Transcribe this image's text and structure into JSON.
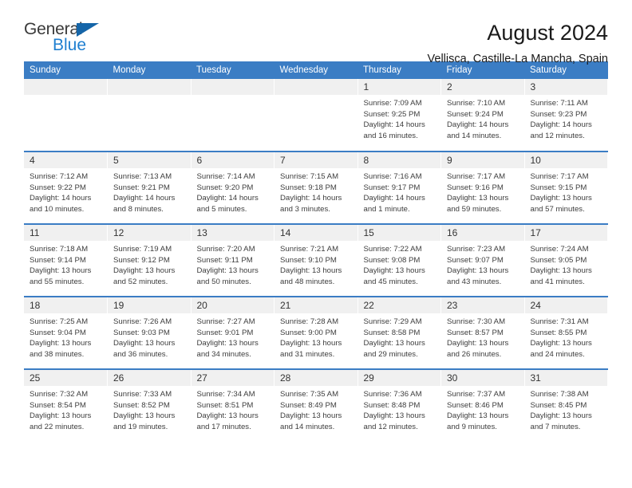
{
  "brand": {
    "name_top": "General",
    "name_bottom": "Blue",
    "accent_color": "#1f7fd0",
    "triangle_color": "#1565a8"
  },
  "header": {
    "title": "August 2024",
    "subtitle": "Vellisca, Castille-La Mancha, Spain"
  },
  "calendar": {
    "header_bg": "#3b7dc4",
    "daynum_bg": "#f0f0f0",
    "weekday_headers": [
      "Sunday",
      "Monday",
      "Tuesday",
      "Wednesday",
      "Thursday",
      "Friday",
      "Saturday"
    ],
    "weeks": [
      [
        {
          "day": "",
          "lines": []
        },
        {
          "day": "",
          "lines": []
        },
        {
          "day": "",
          "lines": []
        },
        {
          "day": "",
          "lines": []
        },
        {
          "day": "1",
          "lines": [
            "Sunrise: 7:09 AM",
            "Sunset: 9:25 PM",
            "Daylight: 14 hours",
            "and 16 minutes."
          ]
        },
        {
          "day": "2",
          "lines": [
            "Sunrise: 7:10 AM",
            "Sunset: 9:24 PM",
            "Daylight: 14 hours",
            "and 14 minutes."
          ]
        },
        {
          "day": "3",
          "lines": [
            "Sunrise: 7:11 AM",
            "Sunset: 9:23 PM",
            "Daylight: 14 hours",
            "and 12 minutes."
          ]
        }
      ],
      [
        {
          "day": "4",
          "lines": [
            "Sunrise: 7:12 AM",
            "Sunset: 9:22 PM",
            "Daylight: 14 hours",
            "and 10 minutes."
          ]
        },
        {
          "day": "5",
          "lines": [
            "Sunrise: 7:13 AM",
            "Sunset: 9:21 PM",
            "Daylight: 14 hours",
            "and 8 minutes."
          ]
        },
        {
          "day": "6",
          "lines": [
            "Sunrise: 7:14 AM",
            "Sunset: 9:20 PM",
            "Daylight: 14 hours",
            "and 5 minutes."
          ]
        },
        {
          "day": "7",
          "lines": [
            "Sunrise: 7:15 AM",
            "Sunset: 9:18 PM",
            "Daylight: 14 hours",
            "and 3 minutes."
          ]
        },
        {
          "day": "8",
          "lines": [
            "Sunrise: 7:16 AM",
            "Sunset: 9:17 PM",
            "Daylight: 14 hours",
            "and 1 minute."
          ]
        },
        {
          "day": "9",
          "lines": [
            "Sunrise: 7:17 AM",
            "Sunset: 9:16 PM",
            "Daylight: 13 hours",
            "and 59 minutes."
          ]
        },
        {
          "day": "10",
          "lines": [
            "Sunrise: 7:17 AM",
            "Sunset: 9:15 PM",
            "Daylight: 13 hours",
            "and 57 minutes."
          ]
        }
      ],
      [
        {
          "day": "11",
          "lines": [
            "Sunrise: 7:18 AM",
            "Sunset: 9:14 PM",
            "Daylight: 13 hours",
            "and 55 minutes."
          ]
        },
        {
          "day": "12",
          "lines": [
            "Sunrise: 7:19 AM",
            "Sunset: 9:12 PM",
            "Daylight: 13 hours",
            "and 52 minutes."
          ]
        },
        {
          "day": "13",
          "lines": [
            "Sunrise: 7:20 AM",
            "Sunset: 9:11 PM",
            "Daylight: 13 hours",
            "and 50 minutes."
          ]
        },
        {
          "day": "14",
          "lines": [
            "Sunrise: 7:21 AM",
            "Sunset: 9:10 PM",
            "Daylight: 13 hours",
            "and 48 minutes."
          ]
        },
        {
          "day": "15",
          "lines": [
            "Sunrise: 7:22 AM",
            "Sunset: 9:08 PM",
            "Daylight: 13 hours",
            "and 45 minutes."
          ]
        },
        {
          "day": "16",
          "lines": [
            "Sunrise: 7:23 AM",
            "Sunset: 9:07 PM",
            "Daylight: 13 hours",
            "and 43 minutes."
          ]
        },
        {
          "day": "17",
          "lines": [
            "Sunrise: 7:24 AM",
            "Sunset: 9:05 PM",
            "Daylight: 13 hours",
            "and 41 minutes."
          ]
        }
      ],
      [
        {
          "day": "18",
          "lines": [
            "Sunrise: 7:25 AM",
            "Sunset: 9:04 PM",
            "Daylight: 13 hours",
            "and 38 minutes."
          ]
        },
        {
          "day": "19",
          "lines": [
            "Sunrise: 7:26 AM",
            "Sunset: 9:03 PM",
            "Daylight: 13 hours",
            "and 36 minutes."
          ]
        },
        {
          "day": "20",
          "lines": [
            "Sunrise: 7:27 AM",
            "Sunset: 9:01 PM",
            "Daylight: 13 hours",
            "and 34 minutes."
          ]
        },
        {
          "day": "21",
          "lines": [
            "Sunrise: 7:28 AM",
            "Sunset: 9:00 PM",
            "Daylight: 13 hours",
            "and 31 minutes."
          ]
        },
        {
          "day": "22",
          "lines": [
            "Sunrise: 7:29 AM",
            "Sunset: 8:58 PM",
            "Daylight: 13 hours",
            "and 29 minutes."
          ]
        },
        {
          "day": "23",
          "lines": [
            "Sunrise: 7:30 AM",
            "Sunset: 8:57 PM",
            "Daylight: 13 hours",
            "and 26 minutes."
          ]
        },
        {
          "day": "24",
          "lines": [
            "Sunrise: 7:31 AM",
            "Sunset: 8:55 PM",
            "Daylight: 13 hours",
            "and 24 minutes."
          ]
        }
      ],
      [
        {
          "day": "25",
          "lines": [
            "Sunrise: 7:32 AM",
            "Sunset: 8:54 PM",
            "Daylight: 13 hours",
            "and 22 minutes."
          ]
        },
        {
          "day": "26",
          "lines": [
            "Sunrise: 7:33 AM",
            "Sunset: 8:52 PM",
            "Daylight: 13 hours",
            "and 19 minutes."
          ]
        },
        {
          "day": "27",
          "lines": [
            "Sunrise: 7:34 AM",
            "Sunset: 8:51 PM",
            "Daylight: 13 hours",
            "and 17 minutes."
          ]
        },
        {
          "day": "28",
          "lines": [
            "Sunrise: 7:35 AM",
            "Sunset: 8:49 PM",
            "Daylight: 13 hours",
            "and 14 minutes."
          ]
        },
        {
          "day": "29",
          "lines": [
            "Sunrise: 7:36 AM",
            "Sunset: 8:48 PM",
            "Daylight: 13 hours",
            "and 12 minutes."
          ]
        },
        {
          "day": "30",
          "lines": [
            "Sunrise: 7:37 AM",
            "Sunset: 8:46 PM",
            "Daylight: 13 hours",
            "and 9 minutes."
          ]
        },
        {
          "day": "31",
          "lines": [
            "Sunrise: 7:38 AM",
            "Sunset: 8:45 PM",
            "Daylight: 13 hours",
            "and 7 minutes."
          ]
        }
      ]
    ]
  }
}
